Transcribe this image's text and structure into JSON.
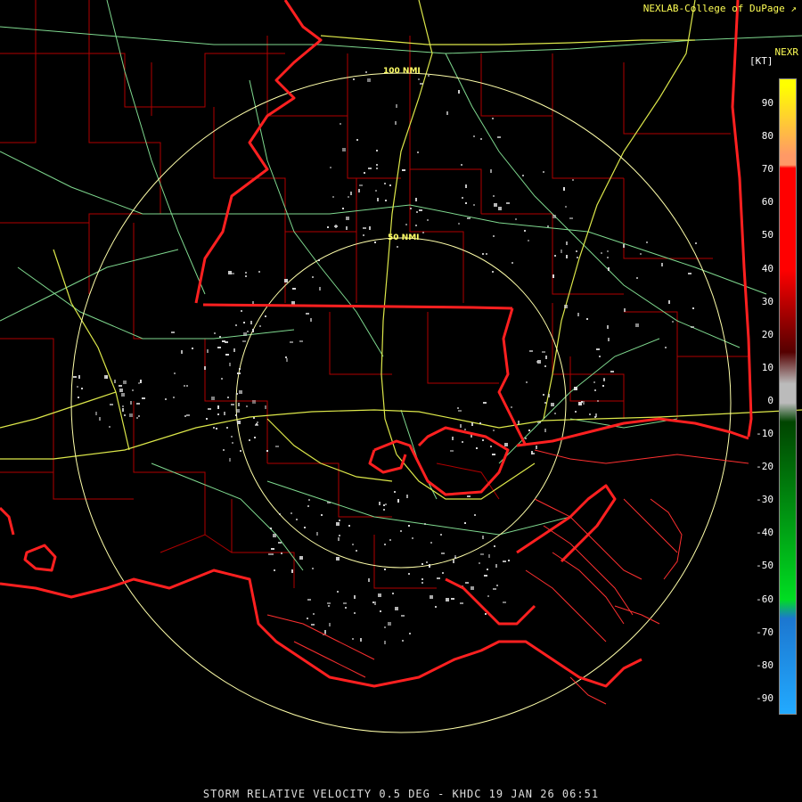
{
  "header": {
    "credit": "NEXLAB-College of DuPage",
    "credit_icon": "external-link-icon",
    "product": "NEXR",
    "unit": "[KT]"
  },
  "footer": {
    "caption": "STORM RELATIVE VELOCITY 0.5 DEG - KHDC 19 JAN 26 06:51"
  },
  "rings": [
    {
      "label": "100 NMI"
    },
    {
      "label": "50 NMI"
    }
  ],
  "legend": {
    "ticks": [
      "90",
      "80",
      "70",
      "60",
      "50",
      "40",
      "30",
      "20",
      "10",
      "0",
      "-10",
      "-20",
      "-30",
      "-40",
      "-50",
      "-60",
      "-70",
      "-80",
      "-90"
    ],
    "colors": {
      "max": "#ffff00",
      "orange": "#ff9966",
      "red": "#ff0000",
      "dark_red": "#550000",
      "gray": "#bbbbbb",
      "dark_green": "#004400",
      "green": "#00dd22",
      "blue": "#1c77d0",
      "light_blue": "#22aaff"
    }
  },
  "colors": {
    "state_border": "#ff2020",
    "county_border": "#c00000",
    "highway": "#ddee44",
    "road": "#88dd99",
    "range_ring": "#ffffaa",
    "echo": "#dddddd"
  }
}
